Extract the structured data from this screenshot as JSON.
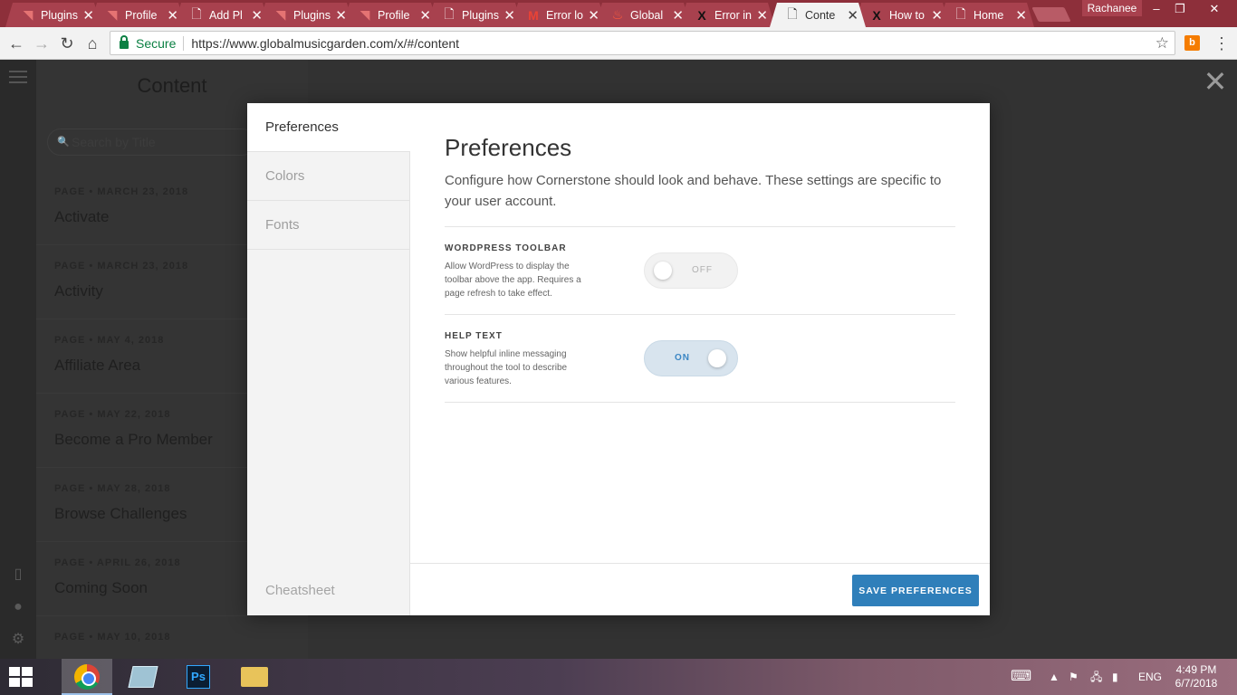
{
  "browser": {
    "tabs": [
      {
        "title": "Plugins",
        "icon": "wp-engine-icon",
        "active": false
      },
      {
        "title": "Profile",
        "icon": "wp-engine-icon",
        "active": false
      },
      {
        "title": "Add Pl",
        "icon": "page-icon",
        "active": false
      },
      {
        "title": "Plugins",
        "icon": "wp-engine-icon",
        "active": false
      },
      {
        "title": "Profile",
        "icon": "wp-engine-icon",
        "active": false
      },
      {
        "title": "Plugins",
        "icon": "page-icon",
        "active": false
      },
      {
        "title": "Error lo",
        "icon": "gmail-icon",
        "active": false
      },
      {
        "title": "Global",
        "icon": "flame-icon",
        "active": false
      },
      {
        "title": "Error in",
        "icon": "x-logo-icon",
        "active": false
      },
      {
        "title": "Conte",
        "icon": "page-icon",
        "active": true
      },
      {
        "title": "How to",
        "icon": "x-logo-icon",
        "active": false
      },
      {
        "title": "Home",
        "icon": "page-icon",
        "active": false
      }
    ],
    "profile_name": "Rachanee",
    "secure_label": "Secure",
    "url": "https://www.globalmusicgarden.com/x/#/content",
    "extension_label": "b"
  },
  "app": {
    "panel_title": "Content",
    "search_placeholder": "Search by Title",
    "items": [
      {
        "meta": "PAGE • MARCH 23, 2018",
        "name": "Activate"
      },
      {
        "meta": "PAGE • MARCH 23, 2018",
        "name": "Activity"
      },
      {
        "meta": "PAGE • MAY 4, 2018",
        "name": "Affiliate Area"
      },
      {
        "meta": "PAGE • MAY 22, 2018",
        "name": "Become a Pro Member"
      },
      {
        "meta": "PAGE • MAY 28, 2018",
        "name": "Browse Challenges"
      },
      {
        "meta": "PAGE • APRIL 26, 2018",
        "name": "Coming Soon"
      },
      {
        "meta": "PAGE • MAY 10, 2018",
        "name": ""
      }
    ]
  },
  "modal": {
    "nav": [
      "Preferences",
      "Colors",
      "Fonts"
    ],
    "cheatsheet": "Cheatsheet",
    "title": "Preferences",
    "description": "Configure how Cornerstone should look and behave. These settings are specific to your user account.",
    "settings": [
      {
        "label": "WORDPRESS TOOLBAR",
        "help": "Allow WordPress to display the toolbar above the app. Requires a page refresh to take effect.",
        "state": "OFF"
      },
      {
        "label": "HELP TEXT",
        "help": "Show helpful inline messaging throughout the tool to describe various features.",
        "state": "ON"
      }
    ],
    "save_label": "SAVE PREFERENCES"
  },
  "taskbar": {
    "apps": [
      "chrome-icon",
      "app-icon",
      "photoshop-icon",
      "file-explorer-icon"
    ],
    "photoshop_label": "Ps",
    "language": "ENG",
    "time": "4:49 PM",
    "date": "6/7/2018"
  },
  "colors": {
    "accent": "#2f7fba",
    "tabstrip": "#8d2f3a",
    "secure": "#0b8043"
  }
}
